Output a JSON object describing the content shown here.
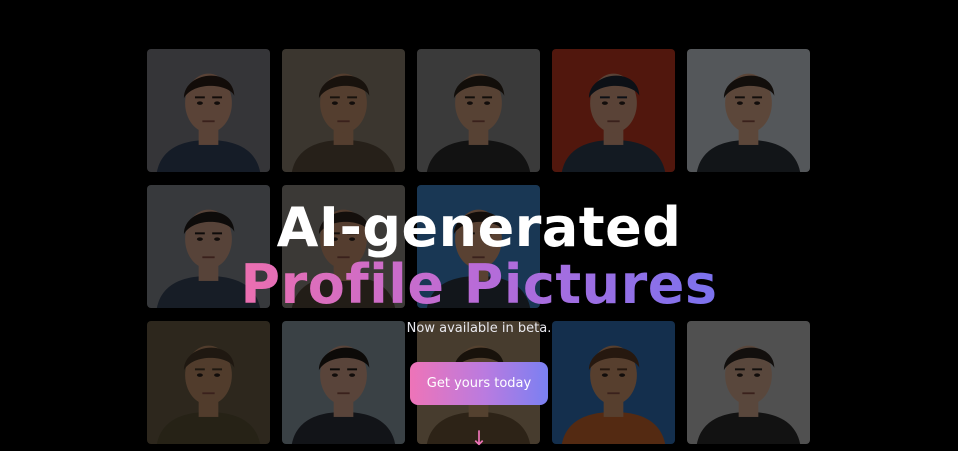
{
  "hero": {
    "title_line1": "AI-generated",
    "title_line2": "Profile Pictures",
    "subtitle": "Now available in beta.",
    "cta_label": "Get yours today",
    "scroll_arrow": "↓"
  },
  "gallery": {
    "tiles": [
      {
        "bg": "#7f7f86",
        "shirt": "#33425e",
        "hair": "#2b1d16",
        "skin": "#d6a084"
      },
      {
        "bg": "#8c8170",
        "shirt": "#5a4d3c",
        "hair": "#3a2a1f",
        "skin": "#c9946f"
      },
      {
        "bg": "#8a8a8a",
        "shirt": "#2a2a2a",
        "hair": "#2c2118",
        "skin": "#cf9c7c"
      },
      {
        "bg": "#c2361f",
        "shirt": "#2d3e52",
        "hair": "#1c2535",
        "skin": "#d6a082"
      },
      {
        "bg": "#c9d0d6",
        "shirt": "#2c3138",
        "hair": "#2a211b",
        "skin": "#dca88a"
      },
      {
        "bg": "#83888e",
        "shirt": "#37445a",
        "hair": "#1f1a18",
        "skin": "#d0a088"
      },
      {
        "bg": "#8d8780",
        "shirt": "#514636",
        "hair": "#2f231c",
        "skin": "#c79270"
      },
      {
        "bg": "#3c83c8",
        "shirt": "#2a3440",
        "hair": "#2a1f18",
        "skin": "#d39a78"
      },
      {
        "bg": "#000000",
        "shirt": "#000000",
        "hair": "#000000",
        "skin": "#000000",
        "empty": true
      },
      {
        "bg": "#000000",
        "shirt": "#000000",
        "hair": "#000000",
        "skin": "#000000",
        "empty": true
      },
      {
        "bg": "#6a5d45",
        "shirt": "#5b5235",
        "hair": "#4a3a28",
        "skin": "#c09069"
      },
      {
        "bg": "#8a9aa5",
        "shirt": "#2b3038",
        "hair": "#1d1714",
        "skin": "#d3a389"
      },
      {
        "bg": "#a98f6e",
        "shirt": "#6a5437",
        "hair": "#3a2a1a",
        "skin": "#c89a70"
      },
      {
        "bg": "#2f6fb7",
        "shirt": "#c7652a",
        "hair": "#5a3a24",
        "skin": "#cf966e"
      },
      {
        "bg": "#bfbfbf",
        "shirt": "#2a2a2a",
        "hair": "#2a2420",
        "skin": "#d4aa90"
      }
    ]
  }
}
